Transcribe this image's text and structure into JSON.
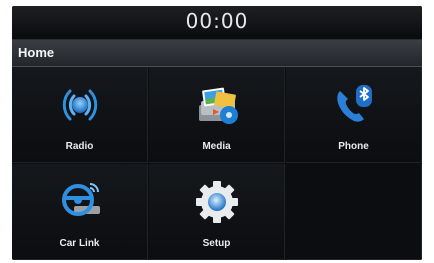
{
  "status": {
    "clock": "00:00"
  },
  "header": {
    "title": "Home"
  },
  "menu": [
    {
      "label": "Radio",
      "icon": "radio-icon"
    },
    {
      "label": "Media",
      "icon": "media-icon"
    },
    {
      "label": "Phone",
      "icon": "bluetooth-phone-icon"
    },
    {
      "label": "Car Link",
      "icon": "car-link-icon"
    },
    {
      "label": "Setup",
      "icon": "gear-icon"
    }
  ],
  "colors": {
    "screen_bg": "#0c0e11",
    "accent_blue": "#2f8fe0"
  }
}
